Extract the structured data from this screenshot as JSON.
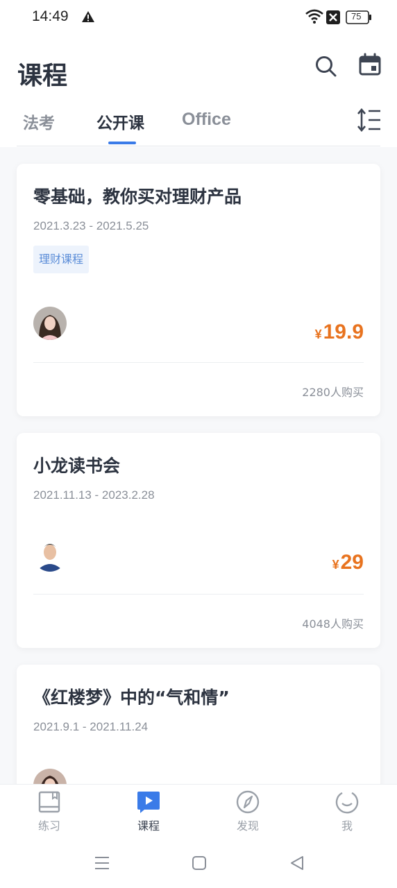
{
  "status_bar": {
    "time": "14:49",
    "battery": "75",
    "icons": [
      "warning-icon",
      "wifi-icon",
      "notification-x-icon",
      "battery-icon"
    ]
  },
  "header": {
    "title": "课程",
    "icons": [
      "search-icon",
      "calendar-icon"
    ]
  },
  "tabs": [
    {
      "label": "法考",
      "active": false
    },
    {
      "label": "公开课",
      "active": true
    },
    {
      "label": "Office",
      "active": false
    }
  ],
  "sort_icon": "sort-icon",
  "courses": [
    {
      "title": "零基础，教你买对理财产品",
      "date": "2021.3.23 - 2021.5.25",
      "tag": "理财课程",
      "currency": "¥",
      "price": "19.9",
      "buyers": "2280人购买",
      "avatar": "teacher-avatar-female"
    },
    {
      "title": "小龙读书会",
      "date": "2021.11.13 - 2023.2.28",
      "currency": "¥",
      "price": "29",
      "buyers": "4048人购买",
      "avatar": "teacher-avatar-male"
    },
    {
      "title": "《红楼梦》中的“气和情”",
      "date": "2021.9.1 - 2021.11.24",
      "avatar": "teacher-avatar-female"
    }
  ],
  "bottom_nav": [
    {
      "label": "练习",
      "icon": "book-icon",
      "active": false
    },
    {
      "label": "课程",
      "icon": "play-icon",
      "active": true
    },
    {
      "label": "发现",
      "icon": "compass-icon",
      "active": false
    },
    {
      "label": "我",
      "icon": "smile-icon",
      "active": false
    }
  ],
  "colors": {
    "accent": "#3a7be8",
    "price": "#e8731f",
    "title": "#2c3340",
    "muted": "#8a8f98",
    "tag_bg": "#edf3fc",
    "tag_text": "#5b8dd8"
  }
}
